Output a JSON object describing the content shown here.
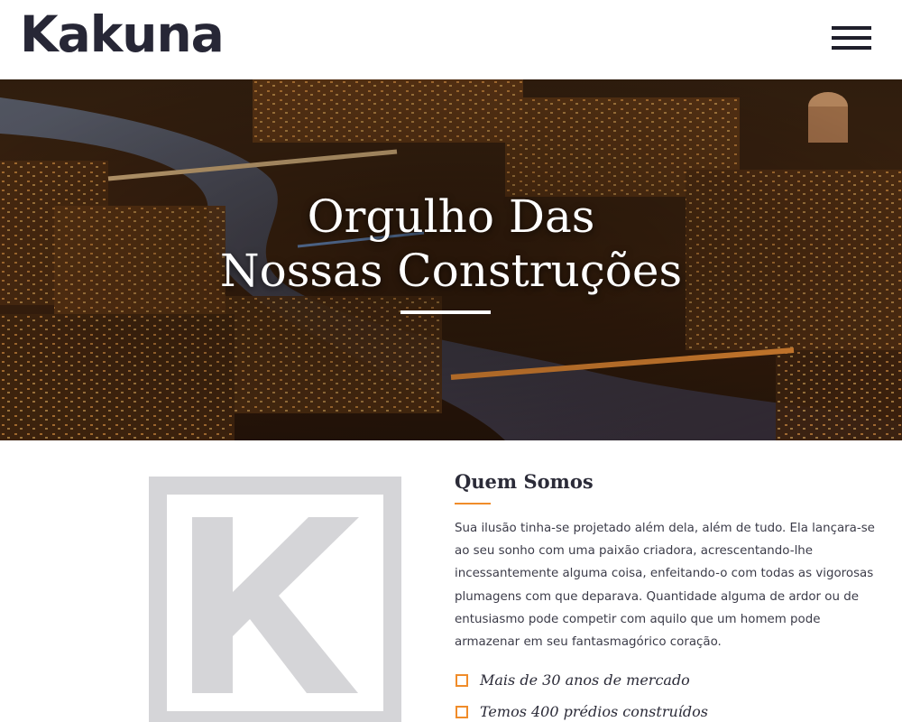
{
  "header": {
    "logo_text": "Kakuna",
    "menu_icon": "hamburger-menu-icon"
  },
  "hero": {
    "title_line1": "Orgulho Das",
    "title_line2": "Nossas Construções",
    "background": "night-city-aerial-photo"
  },
  "about": {
    "logo_letter": "K",
    "title": "Quem Somos",
    "text": "Sua ilusão tinha-se projetado além dela, além de tudo. Ela lançara-se ao seu sonho com uma paixão criadora, acrescentando-lhe incessantemente alguma coisa, enfeitando-o com todas as vigorosas plumagens com que deparava. Quantidade alguma de ardor ou de entusiasmo pode competir com aquilo que um homem pode armazenar em seu fantasmagórico coração.",
    "features": [
      {
        "label": "Mais de 30 anos de mercado",
        "icon": "checkbox-icon"
      },
      {
        "label": "Temos 400 prédios construídos",
        "icon": "checkbox-icon"
      }
    ]
  },
  "colors": {
    "accent": "#f08c2a",
    "dark": "#272736",
    "logo_gray": "#d5d5d8"
  }
}
